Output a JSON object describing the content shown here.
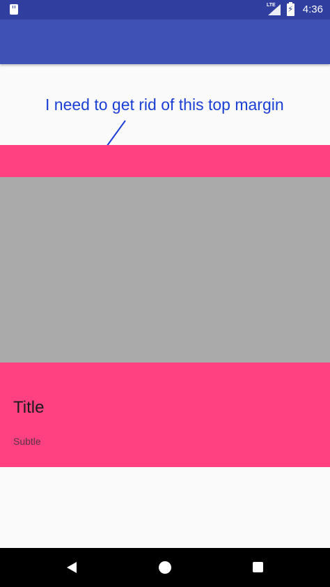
{
  "status_bar": {
    "network": "LTE",
    "time": "4:36",
    "battery_glyph": "⚡",
    "icons": [
      "notification-icon",
      "lte-signal-icon",
      "battery-charging-icon"
    ]
  },
  "annotation": {
    "text": "I need to get rid of this top margin",
    "color": "#1a3fd6"
  },
  "card": {
    "title": "Title",
    "subtitle": "Subtle"
  },
  "colors": {
    "status_bar": "#303f9f",
    "app_bar": "#3f51b5",
    "accent_pink": "#ff4081",
    "media_gray": "#aaaaaa",
    "background": "#fafafa",
    "nav_bar": "#000000"
  },
  "nav_bar": {
    "buttons": [
      "back-icon",
      "home-icon",
      "recents-icon"
    ]
  }
}
